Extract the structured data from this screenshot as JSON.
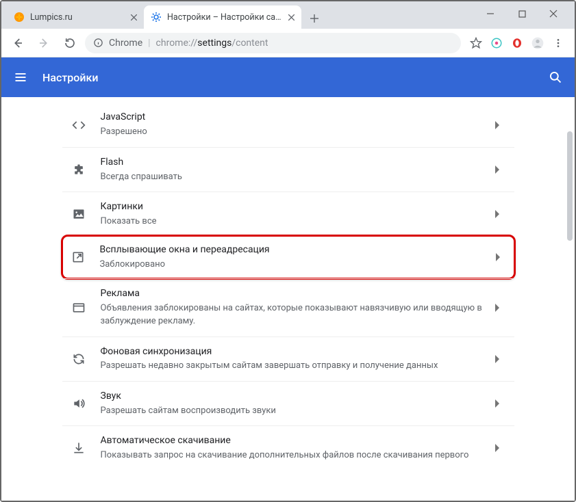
{
  "window": {
    "title_tab1": "Lumpics.ru",
    "title_tab2": "Настройки – Настройки сайта"
  },
  "addr": {
    "chrome_label": "Chrome",
    "url_prefix": "chrome://",
    "url_bold": "settings",
    "url_suffix": "/content"
  },
  "header": {
    "title": "Настройки"
  },
  "rows": {
    "javascript": {
      "title": "JavaScript",
      "sub": "Разрешено"
    },
    "flash": {
      "title": "Flash",
      "sub": "Всегда спрашивать"
    },
    "images": {
      "title": "Картинки",
      "sub": "Показать все"
    },
    "popups": {
      "title": "Всплывающие окна и переадресация",
      "sub": "Заблокировано"
    },
    "ads": {
      "title": "Реклама",
      "sub": "Объявления заблокированы на сайтах, которые показывают навязчивую или вводящую в заблуждение рекламу."
    },
    "bgsync": {
      "title": "Фоновая синхронизация",
      "sub": "Разрешать недавно закрытым сайтам завершать отправку и получение данных"
    },
    "sound": {
      "title": "Звук",
      "sub": "Разрешать сайтам воспроизводить звуки"
    },
    "autodl": {
      "title": "Автоматическое скачивание",
      "sub": "Показывать запрос на скачивание дополнительных файлов после скачивания первого"
    }
  }
}
